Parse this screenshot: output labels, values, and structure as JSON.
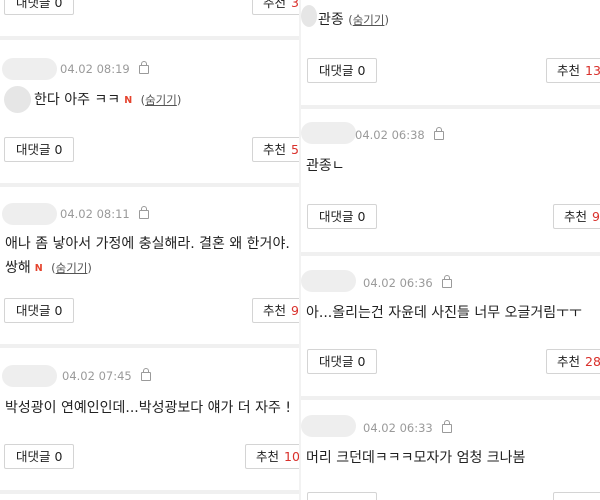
{
  "left": {
    "top_partial": {
      "reply_label": "대댓글",
      "reply_count": "0",
      "rec_label": "추천",
      "rec_count": "3"
    },
    "comments": [
      {
        "timestamp": "04.02 08:19",
        "text": "한다 아주 ㅋㅋ",
        "new_badge": "N",
        "hide_label": "숨기기",
        "reply_label": "대댓글",
        "reply_count": "0",
        "rec_label": "추천",
        "rec_count": "5"
      },
      {
        "timestamp": "04.02 08:11",
        "text_line1": "애나 좀 낳아서 가정에 충실해라. 결혼 왜 한거야.",
        "text_line2": "쌍해",
        "new_badge": "N",
        "hide_label": "숨기기",
        "reply_label": "대댓글",
        "reply_count": "0",
        "rec_label": "추천",
        "rec_count": "9"
      },
      {
        "timestamp": "04.02 07:45",
        "text": "박성광이 연예인인데...박성광보다 얘가 더 자주 !",
        "reply_label": "대댓글",
        "reply_count": "0",
        "rec_label": "추천",
        "rec_count": "10"
      }
    ]
  },
  "right": {
    "top_partial": {
      "text": "관종",
      "hide_label": "숨기기",
      "reply_label": "대댓글",
      "reply_count": "0",
      "rec_label": "추천",
      "rec_count": "13"
    },
    "comments": [
      {
        "timestamp": "04.02 06:38",
        "text": "관종ㄴ",
        "hide_label": "숨기기",
        "reply_label": "대댓글",
        "reply_count": "0",
        "rec_label": "추천",
        "rec_count": "9"
      },
      {
        "timestamp": "04.02 06:36",
        "text": "아...올리는건 자윤데 사진들 너무 오글거림ㅜㅜ",
        "reply_label": "대댓글",
        "reply_count": "0",
        "rec_label": "추천",
        "rec_count": "28"
      },
      {
        "timestamp": "04.02 06:33",
        "text": "머리 크던데ㅋㅋㅋ모자가 엄청 크나봄"
      }
    ]
  }
}
